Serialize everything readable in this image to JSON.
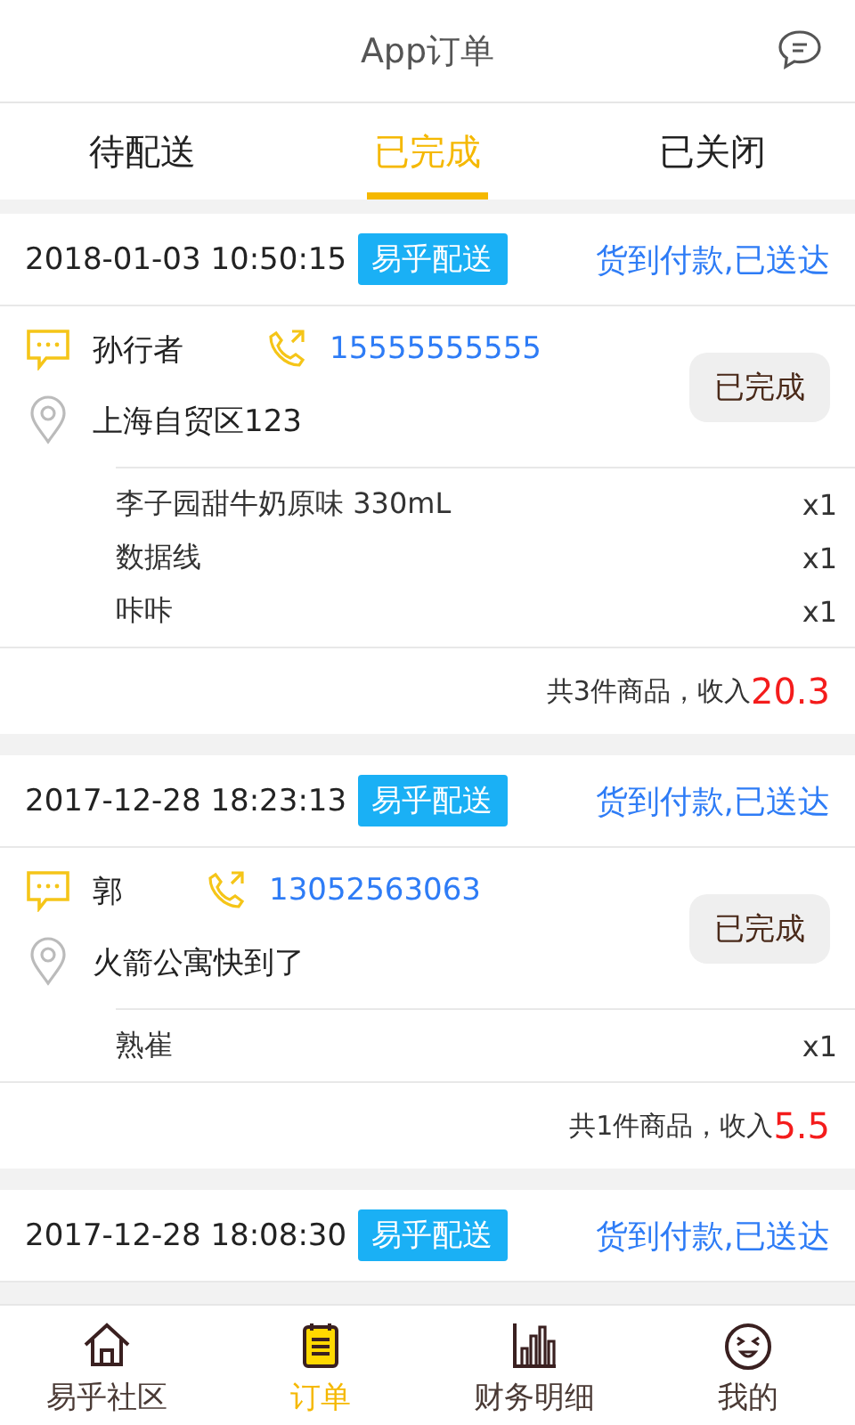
{
  "header": {
    "title": "App订单"
  },
  "tabs": [
    {
      "label": "待配送",
      "selected": false
    },
    {
      "label": "已完成",
      "selected": true
    },
    {
      "label": "已关闭",
      "selected": false
    }
  ],
  "orders": [
    {
      "time": "2018-01-03 10:50:15",
      "tag": "易乎配送",
      "payment_status": "货到付款,已送达",
      "customer": {
        "name": "孙行者",
        "phone": "15555555555",
        "address": "上海自贸区123"
      },
      "state_button": "已完成",
      "items": [
        {
          "name": "李子园甜牛奶原味 330mL",
          "qty": "x1"
        },
        {
          "name": "数据线",
          "qty": "x1"
        },
        {
          "name": "咔咔",
          "qty": "x1"
        }
      ],
      "summary": "共3件商品，收入",
      "income": "20.3"
    },
    {
      "time": "2017-12-28 18:23:13",
      "tag": "易乎配送",
      "payment_status": "货到付款,已送达",
      "customer": {
        "name": "郭",
        "phone": "13052563063",
        "address": "火箭公寓快到了"
      },
      "state_button": "已完成",
      "items": [
        {
          "name": "熟崔",
          "qty": "x1"
        }
      ],
      "summary": "共1件商品，收入",
      "income": "5.5"
    },
    {
      "time": "2017-12-28 18:08:30",
      "tag": "易乎配送",
      "payment_status": "货到付款,已送达"
    }
  ],
  "nav": [
    {
      "label": "易乎社区",
      "kind": "home",
      "selected": false
    },
    {
      "label": "订单",
      "kind": "orders",
      "selected": true
    },
    {
      "label": "财务明细",
      "kind": "chart",
      "selected": false
    },
    {
      "label": "我的",
      "kind": "face",
      "selected": false
    }
  ]
}
